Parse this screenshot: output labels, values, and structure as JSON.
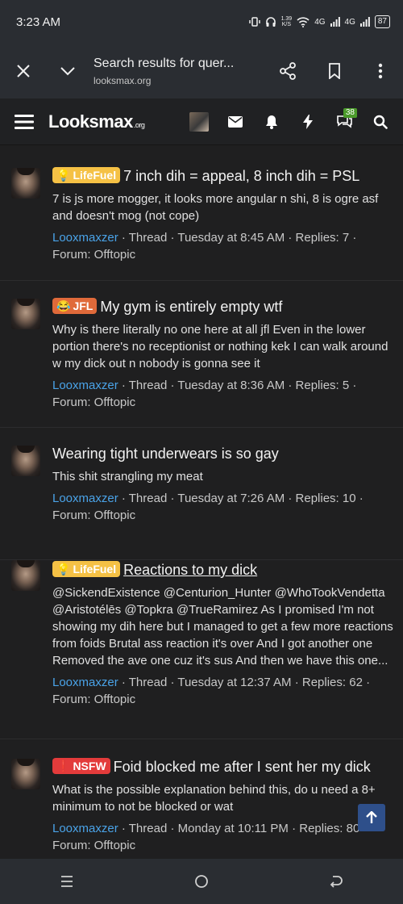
{
  "status": {
    "time": "3:23 AM",
    "net_speed_value": "1.39",
    "net_speed_unit": "K/S",
    "signal1": "4G",
    "signal2": "4G",
    "battery": "87"
  },
  "browser": {
    "title": "Search results for quer...",
    "url": "looksmax.org"
  },
  "site": {
    "logo_main": "Looksmax",
    "logo_suffix": ".org",
    "alerts_badge": "38"
  },
  "results": [
    {
      "prefix": "LifeFuel",
      "prefix_icon": "lightbulb-icon",
      "title": "7 inch dih = appeal, 8 inch dih = PSL",
      "snippet": "7 is js more mogger, it looks more angular n shi, 8 is ogre asf and doesn't mog (not cope)",
      "author": "Looxmaxzer",
      "meta": " · Thread · Tuesday at 8:45 AM · Replies: 7 · Forum: Offtopic"
    },
    {
      "prefix": "JFL",
      "prefix_icon": "laugh-icon",
      "title": "My gym is entirely empty wtf",
      "snippet": "Why is there literally no one here at all jfl Even in the lower portion there's no receptionist or nothing kek I can walk around w my dick out n nobody is gonna see it",
      "author": "Looxmaxzer",
      "meta": " · Thread · Tuesday at 8:36 AM · Replies: 5 · Forum: Offtopic"
    },
    {
      "prefix": "",
      "prefix_icon": "",
      "title": "Wearing tight underwears is so gay",
      "snippet": "This shit strangling my meat",
      "author": "Looxmaxzer",
      "meta": " · Thread · Tuesday at 7:26 AM · Replies: 10 · Forum: Offtopic"
    },
    {
      "prefix": "LifeFuel",
      "prefix_icon": "lightbulb-icon",
      "title": "Reactions to my dick",
      "snippet": "@SickendExistence @Centurion_Hunter @WhoTookVendetta @Aristotélēs @Topkra @TrueRamirez As I promised I'm not showing my dih here but I managed to get a few more reactions from foids Brutal ass reaction it's over And I got another one Removed the ave one cuz it's sus And then we have this one...",
      "author": "Looxmaxzer",
      "meta": " · Thread · Tuesday at 12:37 AM · Replies: 62 · Forum: Offtopic"
    },
    {
      "prefix": "NSFW",
      "prefix_icon": "alert-icon",
      "title": "Foid blocked me after I sent her my dick",
      "snippet": "What is the possible explanation behind this, do u need a 8+ minimum to not be blocked or wat",
      "author": "Looxmaxzer",
      "meta": " · Thread · Monday at 10:11 PM · Replies: 80 · Forum: Offtopic"
    }
  ]
}
